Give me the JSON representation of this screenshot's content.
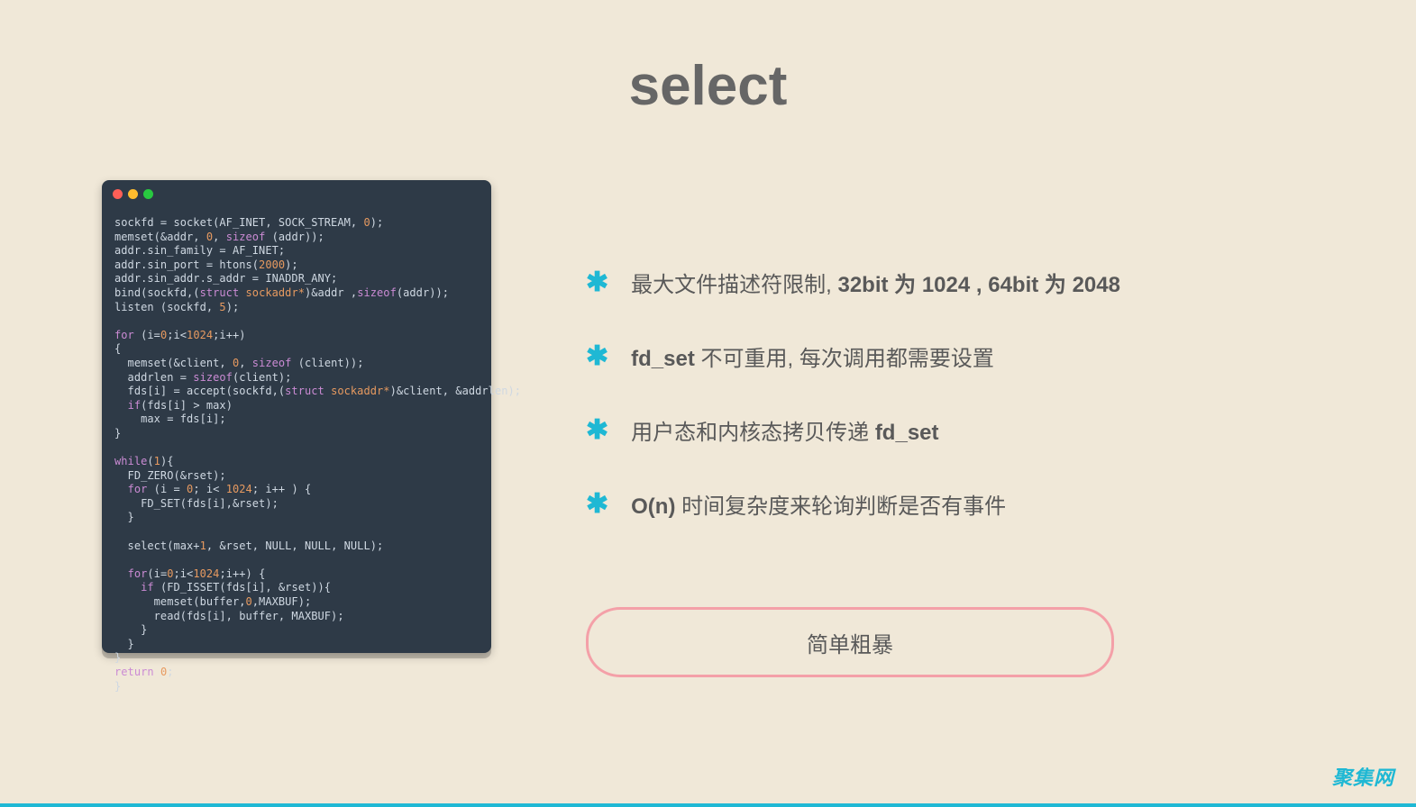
{
  "title": "select",
  "bullets": [
    {
      "plain_pre": "最大文件描述符限制, ",
      "bold": "32bit 为 1024 , 64bit 为 2048",
      "plain_post": ""
    },
    {
      "plain_pre": "",
      "bold": "fd_set",
      "plain_post": " 不可重用, 每次调用都需要设置"
    },
    {
      "plain_pre": "用户态和内核态拷贝传递 ",
      "bold": "fd_set",
      "plain_post": ""
    },
    {
      "plain_pre": "",
      "bold": "O(n)",
      "plain_post": " 时间复杂度来轮询判断是否有事件"
    }
  ],
  "badge": "简单粗暴",
  "watermark": "聚集网",
  "code_lines": [
    [
      [
        "",
        "sockfd = socket(AF_INET, SOCK_STREAM, "
      ],
      [
        "num",
        "0"
      ],
      [
        "",
        ");"
      ]
    ],
    [
      [
        "",
        "memset(&addr, "
      ],
      [
        "num",
        "0"
      ],
      [
        "",
        ", "
      ],
      [
        "kw",
        "sizeof"
      ],
      [
        "",
        " (addr));"
      ]
    ],
    [
      [
        "",
        "addr.sin_family = AF_INET;"
      ]
    ],
    [
      [
        "",
        "addr.sin_port = htons("
      ],
      [
        "num",
        "2000"
      ],
      [
        "",
        ");"
      ]
    ],
    [
      [
        "",
        "addr.sin_addr.s_addr = INADDR_ANY;"
      ]
    ],
    [
      [
        "",
        "bind(sockfd,("
      ],
      [
        "kw",
        "struct"
      ],
      [
        "",
        " "
      ],
      [
        "ty",
        "sockaddr*"
      ],
      [
        "",
        ")&addr ,"
      ],
      [
        "kw",
        "sizeof"
      ],
      [
        "",
        "(addr));"
      ]
    ],
    [
      [
        "",
        "listen (sockfd, "
      ],
      [
        "num",
        "5"
      ],
      [
        "",
        ");"
      ]
    ],
    [
      [
        "",
        ""
      ]
    ],
    [
      [
        "kw",
        "for"
      ],
      [
        "",
        " (i="
      ],
      [
        "num",
        "0"
      ],
      [
        "",
        ";i<"
      ],
      [
        "num",
        "1024"
      ],
      [
        "",
        ";i++)"
      ]
    ],
    [
      [
        "",
        "{"
      ]
    ],
    [
      [
        "",
        "  memset(&client, "
      ],
      [
        "num",
        "0"
      ],
      [
        "",
        ", "
      ],
      [
        "kw",
        "sizeof"
      ],
      [
        "",
        " (client));"
      ]
    ],
    [
      [
        "",
        "  addrlen = "
      ],
      [
        "kw",
        "sizeof"
      ],
      [
        "",
        "(client);"
      ]
    ],
    [
      [
        "",
        "  fds[i] = accept(sockfd,("
      ],
      [
        "kw",
        "struct"
      ],
      [
        "",
        " "
      ],
      [
        "ty",
        "sockaddr*"
      ],
      [
        "",
        ")&client, &addrlen);"
      ]
    ],
    [
      [
        "",
        "  "
      ],
      [
        "kw",
        "if"
      ],
      [
        "",
        "(fds[i] > max)"
      ]
    ],
    [
      [
        "",
        "    max = fds[i];"
      ]
    ],
    [
      [
        "",
        "}"
      ]
    ],
    [
      [
        "",
        ""
      ]
    ],
    [
      [
        "kw",
        "while"
      ],
      [
        "",
        "("
      ],
      [
        "num",
        "1"
      ],
      [
        "",
        "){"
      ]
    ],
    [
      [
        "",
        "  FD_ZERO(&rset);"
      ]
    ],
    [
      [
        "",
        "  "
      ],
      [
        "kw",
        "for"
      ],
      [
        "",
        " (i = "
      ],
      [
        "num",
        "0"
      ],
      [
        "",
        "; i< "
      ],
      [
        "num",
        "1024"
      ],
      [
        "",
        "; i++ ) {"
      ]
    ],
    [
      [
        "",
        "    FD_SET(fds[i],&rset);"
      ]
    ],
    [
      [
        "",
        "  }"
      ]
    ],
    [
      [
        "",
        ""
      ]
    ],
    [
      [
        "",
        "  select(max+"
      ],
      [
        "num",
        "1"
      ],
      [
        "",
        ", &rset, NULL, NULL, NULL);"
      ]
    ],
    [
      [
        "",
        ""
      ]
    ],
    [
      [
        "",
        "  "
      ],
      [
        "kw",
        "for"
      ],
      [
        "",
        "(i="
      ],
      [
        "num",
        "0"
      ],
      [
        "",
        ";i<"
      ],
      [
        "num",
        "1024"
      ],
      [
        "",
        ";i++) {"
      ]
    ],
    [
      [
        "",
        "    "
      ],
      [
        "kw",
        "if"
      ],
      [
        "",
        " (FD_ISSET(fds[i], &rset)){"
      ]
    ],
    [
      [
        "",
        "      memset(buffer,"
      ],
      [
        "num",
        "0"
      ],
      [
        "",
        ",MAXBUF);"
      ]
    ],
    [
      [
        "",
        "      read(fds[i], buffer, MAXBUF);"
      ]
    ],
    [
      [
        "",
        "    }"
      ]
    ],
    [
      [
        "",
        "  }"
      ]
    ],
    [
      [
        "",
        "}"
      ]
    ],
    [
      [
        "kw",
        "return"
      ],
      [
        "",
        " "
      ],
      [
        "num",
        "0"
      ],
      [
        "",
        ";"
      ]
    ],
    [
      [
        "",
        "}"
      ]
    ]
  ]
}
